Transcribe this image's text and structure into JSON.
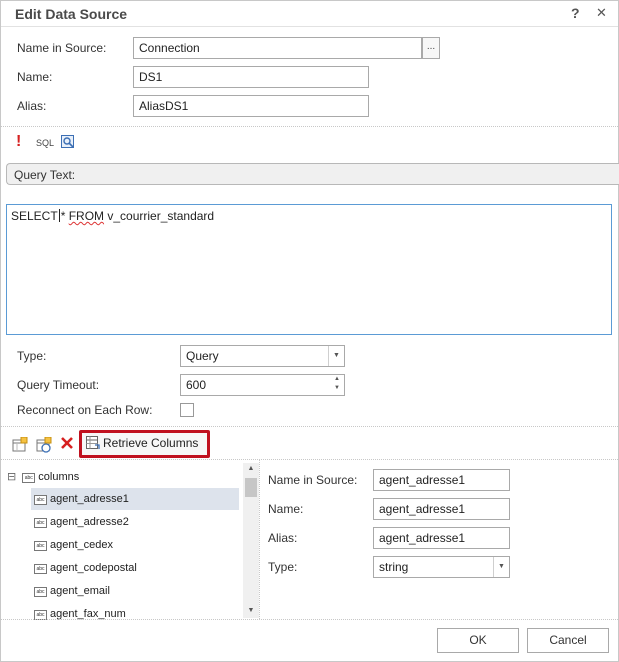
{
  "dialog": {
    "title": "Edit Data Source",
    "help_label": "?",
    "close_label": "✕"
  },
  "form": {
    "name_in_source_label": "Name in Source:",
    "name_in_source_value": "Connection",
    "dots_label": "...",
    "name_label": "Name:",
    "name_value": "DS1",
    "alias_label": "Alias:",
    "alias_value": "AliasDS1"
  },
  "toolbar": {
    "exclamation": "!",
    "sql_label": "SQL",
    "icons": [
      "run-icon",
      "sql-icon",
      "query-builder-icon"
    ]
  },
  "query": {
    "header": "Query Text:",
    "text_before_cursor": "SELECT",
    "text_star": "* ",
    "text_keyword": "FROM",
    "text_rest": " v_courrier_standard"
  },
  "options": {
    "type_label": "Type:",
    "type_value": "Query",
    "timeout_label": "Query Timeout:",
    "timeout_value": "600",
    "reconnect_label": "Reconnect on Each Row:",
    "reconnect_checked": false
  },
  "columns_toolbar": {
    "retrieve_label": "Retrieve Columns",
    "icons": [
      "new-column-icon",
      "new-calculated-column-icon",
      "delete-icon",
      "retrieve-columns-icon"
    ]
  },
  "tree": {
    "root_label": "columns",
    "expander": "⊟",
    "items": [
      "agent_adresse1",
      "agent_adresse2",
      "agent_cedex",
      "agent_codepostal",
      "agent_email",
      "agent_fax_num"
    ],
    "selected_index": 0
  },
  "column_props": {
    "name_in_source_label": "Name in Source:",
    "name_in_source_value": "agent_adresse1",
    "name_label": "Name:",
    "name_value": "agent_adresse1",
    "alias_label": "Alias:",
    "alias_value": "agent_adresse1",
    "type_label": "Type:",
    "type_value": "string"
  },
  "footer": {
    "ok_label": "OK",
    "cancel_label": "Cancel"
  },
  "colors": {
    "accent_red": "#c0111f",
    "focus_blue": "#5b9bd5",
    "selection": "#dde3ec"
  }
}
